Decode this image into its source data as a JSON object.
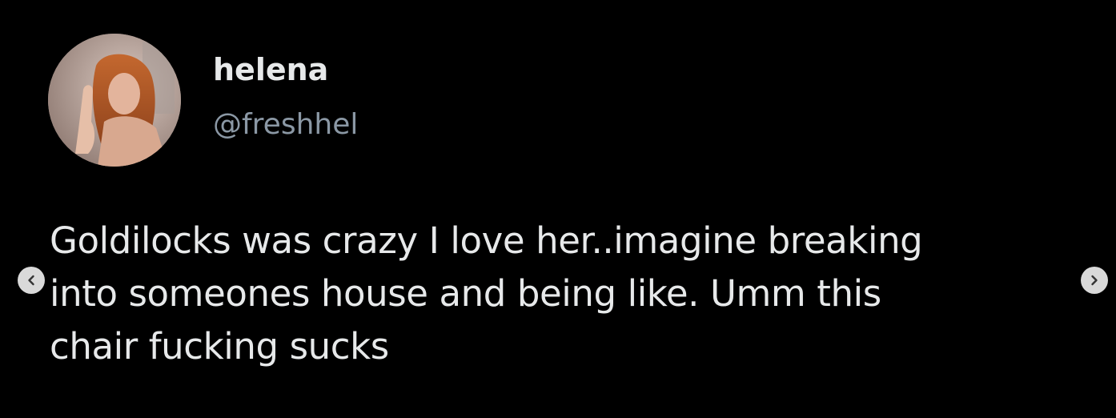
{
  "author": {
    "display_name": "helena",
    "handle": "@freshhel",
    "avatar_icon": "profile-photo"
  },
  "tweet": {
    "lines": [
      "Goldilocks was crazy I love her..imagine breaking",
      "into someones house and being like. Umm this",
      "chair fucking sucks"
    ]
  },
  "carousel": {
    "prev_icon": "chevron-left-icon",
    "next_icon": "chevron-right-icon"
  },
  "colors": {
    "background": "#000000",
    "primary_text": "#e7e9ea",
    "secondary_text": "#8b98a5",
    "nav_button": "#d9d9d9"
  }
}
